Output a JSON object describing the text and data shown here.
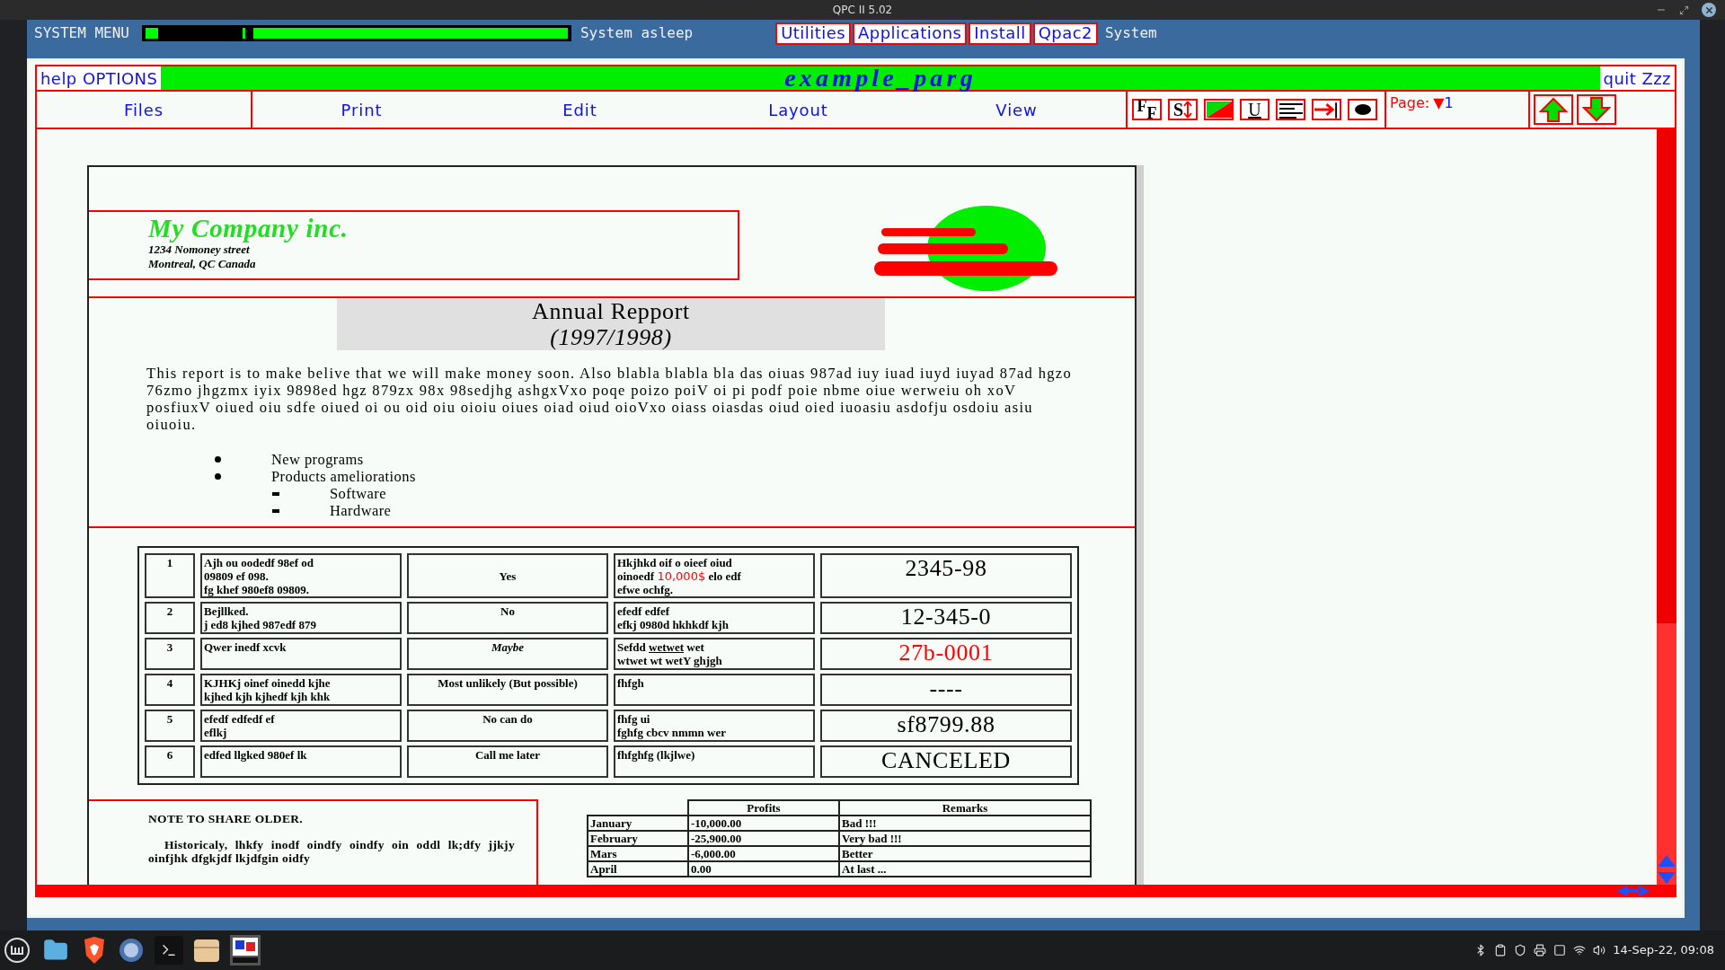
{
  "window": {
    "title": "QPC II 5.02"
  },
  "system_bar": {
    "label": "SYSTEM MENU",
    "status": "System asleep",
    "menus": [
      {
        "label": "Utilities",
        "kind": "boxed"
      },
      {
        "label": "Applications",
        "kind": "boxed"
      },
      {
        "label": "Install",
        "kind": "boxed"
      },
      {
        "label": "Qpac2",
        "kind": "boxed"
      },
      {
        "label": "System",
        "kind": "plain"
      }
    ]
  },
  "app": {
    "help": "help OPTIONS",
    "title": "example_parg",
    "quit": "quit Zzz",
    "menu": [
      "Files",
      "Print",
      "Edit",
      "Layout",
      "View"
    ],
    "tools": [
      {
        "kind": "font",
        "labels": [
          "F",
          "F"
        ]
      },
      {
        "kind": "style",
        "labels": [
          "S"
        ]
      },
      {
        "kind": "color"
      },
      {
        "kind": "underline",
        "labels": [
          "U"
        ]
      },
      {
        "kind": "align"
      },
      {
        "kind": "tab"
      },
      {
        "kind": "bullet"
      }
    ],
    "page": {
      "label": "Page:",
      "arrow": "▼",
      "number": "1"
    }
  },
  "document": {
    "company": {
      "name": "My Company inc.",
      "address": [
        "1234 Nomoney street",
        "Montreal, QC Canada"
      ]
    },
    "heading": {
      "title": "Annual Repport",
      "years": "(1997/1998)"
    },
    "paragraph": "This report is to make belive that we will make money soon. Also blabla blabla bla das oiuas 987ad iuy iuad iuyd iuyad 87ad hgzo 76zmo jhgzmx iyix 9898ed hgz 879zx 98x 98sedjhg ashgxVxo poqe poizo poiV oi pi podf poie nbme oiue werweiu oh xoV posfiuxV oiued oiu sdfe oiued oi ou oid oiu oioiu oiues oiad oiud oioVxo oiass oiasdas oiud oied iuoasiu asdofju osdoiu asiu oiuoiu.",
    "bullets": [
      {
        "text": "New programs"
      },
      {
        "text": "Products ameliorations",
        "children": [
          {
            "text": "Software"
          },
          {
            "text": "Hardware"
          }
        ]
      }
    ],
    "rows": [
      {
        "number": "1",
        "description": [
          "Ajh ou oodedf 98ef od",
          "09809 ef 098.",
          "fg khef 980ef8 09809."
        ],
        "answer": "Yes",
        "italic": false,
        "details": [
          [
            {
              "kind": "plain",
              "text": "Hkjhkd oif o oieef oiud"
            }
          ],
          [
            {
              "kind": "plain",
              "text": "oinoedf "
            },
            {
              "kind": "red",
              "text": "10,000$"
            },
            {
              "kind": "plain",
              "text": " elo edf"
            }
          ],
          [
            {
              "kind": "plain",
              "text": "efwe ochfg."
            }
          ]
        ],
        "code": "2345-98",
        "color": "#000000"
      },
      {
        "number": "2",
        "description": [
          "Bejllked.",
          "j ed8 kjhed 987edf 879"
        ],
        "answer": "No",
        "italic": false,
        "details": [
          [
            {
              "kind": "plain",
              "text": "efedf edfef"
            }
          ],
          [
            {
              "kind": "plain",
              "text": "efkj 0980d hkhkdf kjh"
            }
          ]
        ],
        "code": "12-345-0",
        "color": "#000000"
      },
      {
        "number": "3",
        "description": [
          "Qwer inedf xcvk"
        ],
        "answer": "Maybe",
        "italic": true,
        "details": [
          [
            {
              "kind": "plain",
              "text": "Sefdd "
            },
            {
              "kind": "underline",
              "text": "wetwet"
            },
            {
              "kind": "plain",
              "text": " wet"
            }
          ],
          [
            {
              "kind": "plain",
              "text": "wtwet wt wetY ghjgh"
            }
          ]
        ],
        "code": "27b-0001",
        "color": "#ff0000"
      },
      {
        "number": "4",
        "description": [
          "KJHKj oinef oinedd kjhe",
          "kjhed kjh kjhedf kjh khk"
        ],
        "answer": "Most unlikely (But possible)",
        "italic": false,
        "details": [
          [
            {
              "kind": "plain",
              "text": "fhfgh"
            }
          ]
        ],
        "code": "----",
        "color": "#000000"
      },
      {
        "number": "5",
        "description": [
          "efedf edfedf ef",
          "eflkj"
        ],
        "answer": "No can do",
        "italic": false,
        "details": [
          [
            {
              "kind": "plain",
              "text": "fhfg ui"
            }
          ],
          [
            {
              "kind": "plain",
              "text": "fghfg cbcv nmmn wer"
            }
          ]
        ],
        "code": "sf8799.88",
        "color": "#000000"
      },
      {
        "number": "6",
        "description": [
          "edfed llgked 980ef lk"
        ],
        "answer": "Call me later",
        "italic": false,
        "details": [
          [
            {
              "kind": "plain",
              "text": "fhfghfg (lkjlwe)"
            }
          ]
        ],
        "code": "CANCELED",
        "color": "#000000"
      }
    ],
    "note": {
      "title": "NOTE TO SHARE OLDER.",
      "text": "Historicaly, lhkfy inodf oindfy oindfy oin oddl lk;dfy jjkjy oinfjhk dfgkjdf lkjdfgin oidfy"
    },
    "profits": {
      "columns": [
        "",
        "Profits",
        "Remarks"
      ],
      "rows": [
        [
          "January",
          "-10,000.00",
          "Bad !!!"
        ],
        [
          "February",
          "-25,900.00",
          "Very bad !!!"
        ],
        [
          "Mars",
          "-6,000.00",
          "Better"
        ],
        [
          "April",
          "0.00",
          "At last ..."
        ]
      ]
    }
  },
  "taskbar": {
    "clock": "14-Sep-22, 09:08"
  }
}
